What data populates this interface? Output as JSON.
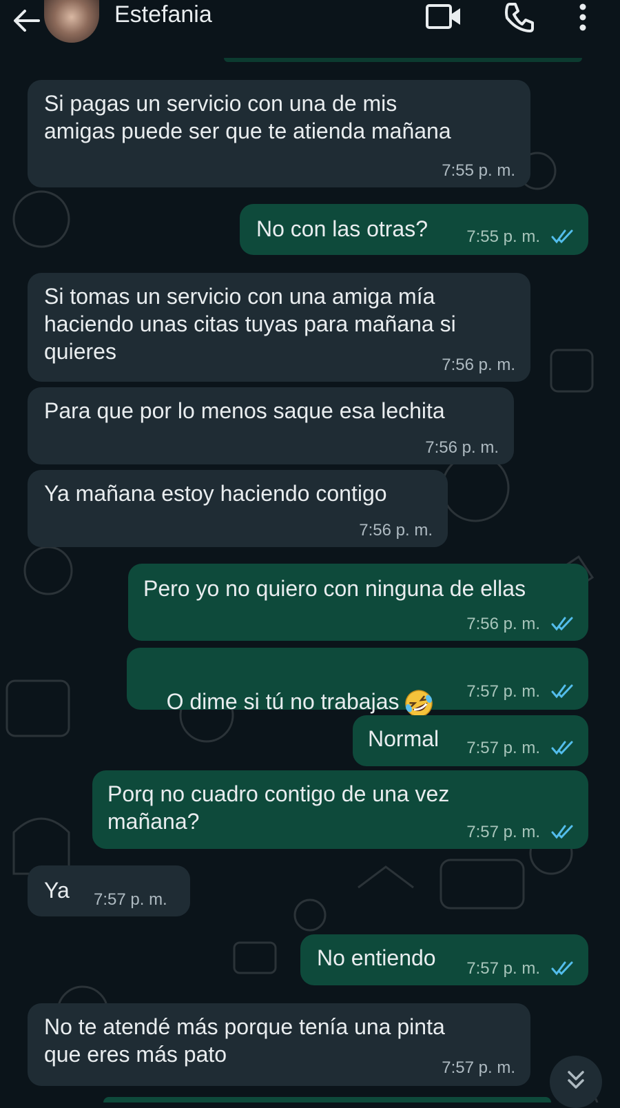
{
  "header": {
    "contact_name": "Estefania"
  },
  "messages": [
    {
      "dir": "in",
      "text": "Si pagas un servicio con una de mis\namigas puede ser que te atienda mañana",
      "time": "7:55 p. m."
    },
    {
      "dir": "out",
      "text": "No con las otras?",
      "time": "7:55 p. m.",
      "status": "read"
    },
    {
      "dir": "in",
      "text": "Si tomas un servicio con una amiga mía\nhaciendo unas citas tuyas para mañana si\nquieres",
      "time": "7:56 p. m."
    },
    {
      "dir": "in",
      "text": "Para que por lo menos saque esa lechita",
      "time": "7:56 p. m."
    },
    {
      "dir": "in",
      "text": "Ya mañana estoy haciendo contigo",
      "time": "7:56 p. m."
    },
    {
      "dir": "out",
      "text": "Pero yo no quiero con ninguna de ellas",
      "time": "7:56 p. m.",
      "status": "read"
    },
    {
      "dir": "out",
      "text": "O dime si tú no trabajas",
      "emoji": "rolling-on-floor-laughing-emoji",
      "time": "7:57 p. m.",
      "status": "read"
    },
    {
      "dir": "out",
      "text": "Normal",
      "time": "7:57 p. m.",
      "status": "read"
    },
    {
      "dir": "out",
      "text": "Porq no cuadro contigo de una vez\nmañana?",
      "time": "7:57 p. m.",
      "status": "read"
    },
    {
      "dir": "in",
      "text": "Ya",
      "time": "7:57 p. m."
    },
    {
      "dir": "out",
      "text": "No entiendo",
      "time": "7:57 p. m.",
      "status": "read"
    },
    {
      "dir": "in",
      "text": "No te atendé más porque tenía una pinta\nque eres más pato",
      "time": "7:57 p. m."
    }
  ],
  "colors": {
    "background": "#0b141a",
    "incoming_bubble": "#1f2c34",
    "outgoing_bubble": "#0e4a3b",
    "read_ticks": "#53bdeb"
  },
  "icons": [
    "back-arrow-icon",
    "video-call-icon",
    "phone-icon",
    "more-options-icon",
    "double-check-icon",
    "chevron-double-down-icon"
  ]
}
